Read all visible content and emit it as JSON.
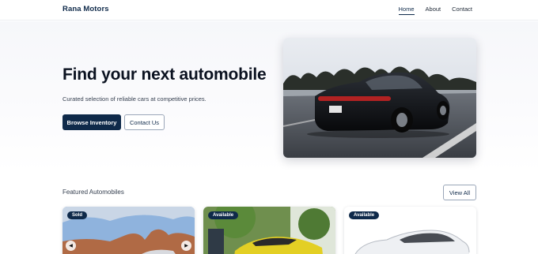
{
  "header": {
    "brand": "Rana Motors",
    "nav": [
      {
        "label": "Home",
        "active": true
      },
      {
        "label": "About",
        "active": false
      },
      {
        "label": "Contact",
        "active": false
      }
    ]
  },
  "hero": {
    "title": "Find your next automobile",
    "subtitle": "Curated selection of reliable cars at competitive prices.",
    "primary_button": "Browse Inventory",
    "secondary_button": "Contact Us"
  },
  "featured": {
    "title": "Featured Automobiles",
    "view_all": "View All",
    "cards": [
      {
        "status": "Sold",
        "prev_icon": "chevron-left-icon",
        "next_icon": "chevron-right-icon"
      },
      {
        "status": "Available"
      },
      {
        "status": "Available"
      }
    ]
  },
  "icons": {
    "prev": "◀",
    "next": "▶"
  },
  "colors": {
    "brand": "#0f2a4a",
    "text": "#111827",
    "muted": "#374151",
    "border": "#9aa6b8"
  }
}
